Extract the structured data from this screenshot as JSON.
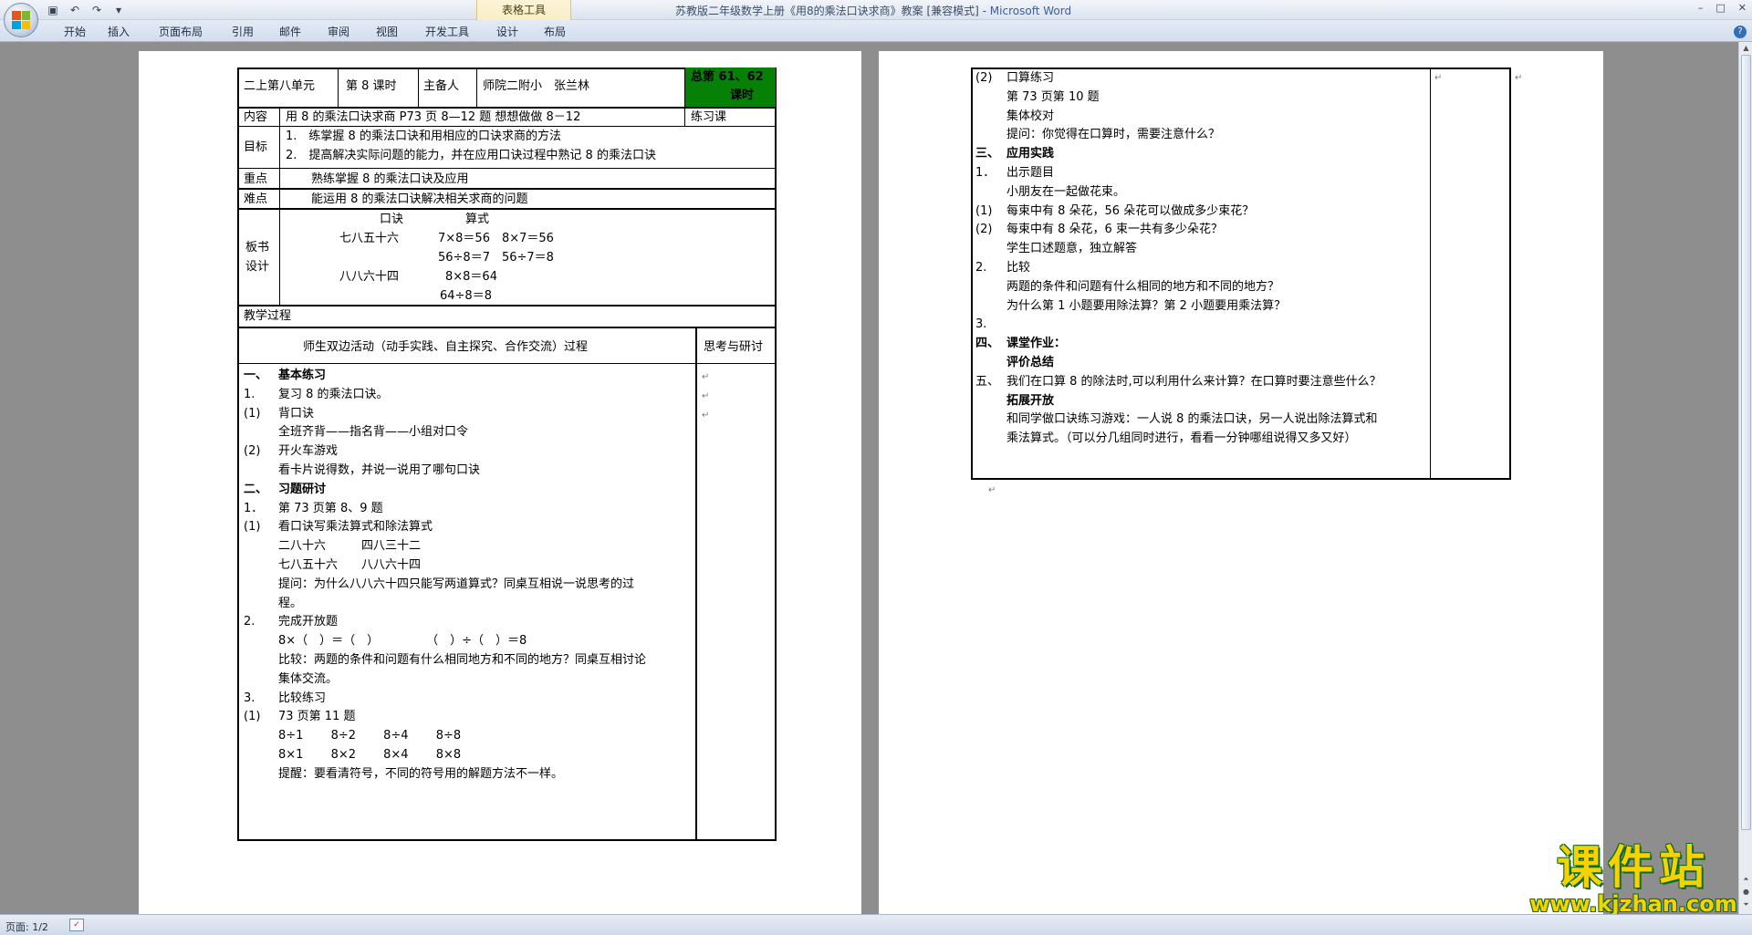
{
  "window": {
    "title": "苏教版二年级数学上册《用8的乘法口诀求商》教案 [兼容模式] -",
    "app_name": "Microsoft Word",
    "context_tab": "表格工具",
    "controls": [
      "–",
      "□",
      "✕"
    ]
  },
  "ribbon": {
    "tabs": [
      "开始",
      "插入",
      "页面布局",
      "引用",
      "邮件",
      "审阅",
      "视图",
      "开发工具",
      "设计",
      "布局"
    ]
  },
  "statusbar": {
    "page_info": "页面: 1/2"
  },
  "watermark": {
    "line1": "课件站",
    "line2": "www.kjzhan.com"
  },
  "page1": {
    "header": {
      "unit": "二上第八单元",
      "period": "第 8 课时",
      "preparer_label": "主备人",
      "preparer": "师院二附小　张兰林",
      "total_line1": "总第 61、62",
      "total_line2": "课时"
    },
    "content_label": "内容",
    "content": "用 8 的乘法口诀求商 P73 页 8—12 题 想想做做 8－12",
    "lesson_type": "练习课",
    "goal_label": "目标",
    "goals": [
      "1.　练掌握 8 的乘法口诀和用相应的口诀求商的方法",
      "2.　提高解决实际问题的能力，并在应用口诀过程中熟记 8 的乘法口诀"
    ],
    "key_label": "重点",
    "key_point": "熟练掌握 8 的乘法口诀及应用",
    "difficulty_label": "难点",
    "difficulty": "能运用 8 的乘法口诀解决相关求商的问题",
    "board_label_1": "板书",
    "board_label_2": "设计",
    "board": {
      "head_rhyme": "口诀",
      "head_formula": "算式",
      "rhyme1": "七八五十六",
      "rhyme2": "八八六十四",
      "f1": "7×8＝56　8×7＝56",
      "f2": "56÷8＝7　56÷7＝8",
      "f3": "8×8＝64",
      "f4": "64÷8＝8"
    },
    "process_label": "教学过程",
    "activity_header": "师生双边活动（动手实践、自主探究、合作交流）过程",
    "reflect_header": "思考与研讨",
    "lines": [
      {
        "num": "一、",
        "text": "基本练习",
        "bold": true
      },
      {
        "num": "1.",
        "text": "复习 8 的乘法口诀。",
        "bold": false
      },
      {
        "num": "(1)",
        "text": "背口诀",
        "bold": false
      },
      {
        "num": "",
        "text": "全班齐背——指名背——小组对口令",
        "bold": false
      },
      {
        "num": "(2)",
        "text": "开火车游戏",
        "bold": false
      },
      {
        "num": "",
        "text": "看卡片说得数，并说一说用了哪句口诀",
        "bold": false
      },
      {
        "num": "二、",
        "text": "习题研讨",
        "bold": true
      },
      {
        "num": "1．",
        "text": "第 73 页第 8、9 题",
        "bold": false
      },
      {
        "num": "(1)",
        "text": "看口诀写乘法算式和除法算式",
        "bold": false
      },
      {
        "num": "",
        "text": "二八十六　　　四八三十二",
        "bold": false
      },
      {
        "num": "",
        "text": "七八五十六　　八八六十四",
        "bold": false
      },
      {
        "num": "",
        "text": "提问：为什么八八六十四只能写两道算式？同桌互相说一说思考的过",
        "bold": false
      },
      {
        "num": "",
        "text": "程。",
        "bold": false
      },
      {
        "num": "2.",
        "text": "完成开放题",
        "bold": false
      },
      {
        "num": "",
        "text": "8×（　）＝（　）　　　　　（　）÷（　）＝8",
        "bold": false
      },
      {
        "num": "",
        "text": "比较：两题的条件和问题有什么相同地方和不同的地方？同桌互相讨论",
        "bold": false
      },
      {
        "num": "",
        "text": "集体交流。",
        "bold": false
      },
      {
        "num": "3.",
        "text": "比较练习",
        "bold": false
      },
      {
        "num": "(1)",
        "text": "73 页第 11 题",
        "bold": false
      },
      {
        "num": "",
        "text": "8÷1　　 8÷2　　 8÷4　　 8÷8",
        "bold": false
      },
      {
        "num": "",
        "text": "8×1　　 8×2　　 8×4　　 8×8",
        "bold": false
      },
      {
        "num": "",
        "text": "提醒：要看清符号，不同的符号用的解题方法不一样。",
        "bold": false
      }
    ]
  },
  "page2": {
    "lines": [
      {
        "num": "(2)",
        "text": "口算练习",
        "bold": false
      },
      {
        "num": "",
        "text": "第 73 页第 10 题",
        "bold": false
      },
      {
        "num": "",
        "text": "集体校对",
        "bold": false
      },
      {
        "num": "",
        "text": "提问：你觉得在口算时，需要注意什么？",
        "bold": false
      },
      {
        "num": "三、",
        "text": "应用实践",
        "bold": true
      },
      {
        "num": "1．",
        "text": "出示题目",
        "bold": false
      },
      {
        "num": "",
        "text": "小朋友在一起做花束。",
        "bold": false
      },
      {
        "num": "(1)",
        "text": "每束中有 8 朵花，56 朵花可以做成多少束花？",
        "bold": false
      },
      {
        "num": "(2)",
        "text": "每束中有 8 朵花，6 束一共有多少朵花？",
        "bold": false
      },
      {
        "num": "",
        "text": "学生口述题意，独立解答",
        "bold": false
      },
      {
        "num": "2.",
        "text": "比较",
        "bold": false
      },
      {
        "num": "",
        "text": "两题的条件和问题有什么相同的地方和不同的地方？",
        "bold": false
      },
      {
        "num": "",
        "text": "为什么第 1 小题要用除法算？第 2 小题要用乘法算？",
        "bold": false
      },
      {
        "num": "3.",
        "text": "",
        "bold": false
      },
      {
        "num": "四、",
        "text": "课堂作业：",
        "bold": true
      },
      {
        "num": "",
        "text": "评价总结",
        "bold": true
      },
      {
        "num": "五、",
        "text": "我们在口算 8 的除法时,可以利用什么来计算？在口算时要注意些什么？",
        "bold": false
      },
      {
        "num": "",
        "text": "拓展开放",
        "bold": true
      },
      {
        "num": "",
        "text": "和同学做口诀练习游戏：一人说 8 的乘法口诀，另一人说出除法算式和",
        "bold": false
      },
      {
        "num": "",
        "text": "乘法算式。（可以分几组同时进行，看看一分钟哪组说得又多又好）",
        "bold": false
      }
    ]
  }
}
